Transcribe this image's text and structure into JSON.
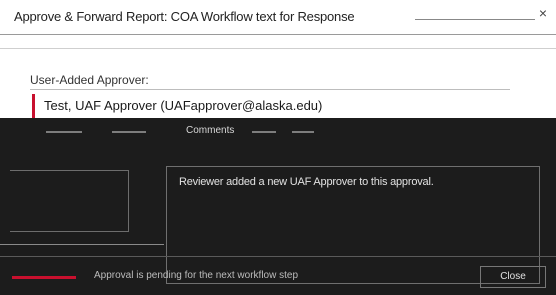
{
  "dialog": {
    "title": "Approve & Forward Report: COA Workflow text for Response",
    "close_label": "×"
  },
  "approver_section": {
    "label": "User-Added Approver:",
    "value": "Test, UAF Approver (UAFapprover@alaska.edu)"
  },
  "tabs": [
    {
      "label": "Status"
    },
    {
      "label": "History"
    },
    {
      "label": "Comments"
    },
    {
      "label": "Notes"
    },
    {
      "label": "Files"
    }
  ],
  "comment": {
    "text": "Reviewer added a new UAF Approver to this approval."
  },
  "footer": {
    "status_text": "Approval is pending for the next workflow step",
    "action_label": "Close"
  },
  "colors": {
    "accent": "#c8102e",
    "panel": "#1c1c1c",
    "panel_text": "#e2e2e2"
  }
}
